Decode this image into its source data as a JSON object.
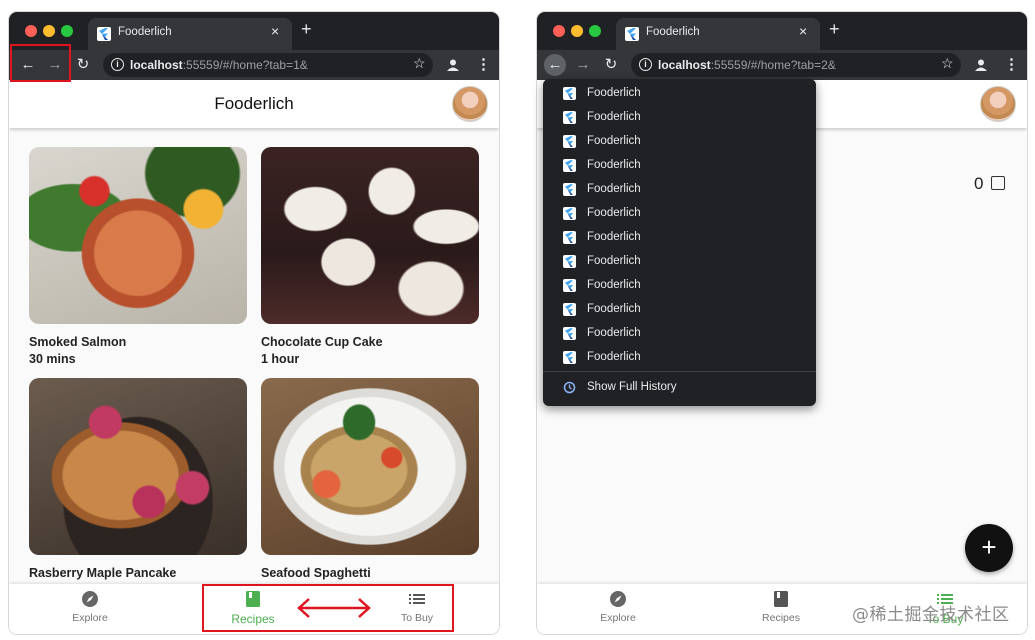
{
  "left_window": {
    "tab_title": "Fooderlich",
    "url_host": "localhost",
    "url_rest": ":55559/#/home?tab=1&",
    "app_title": "Fooderlich",
    "recipes": [
      {
        "title": "Smoked Salmon",
        "subtitle": "30 mins"
      },
      {
        "title": "Chocolate Cup Cake",
        "subtitle": "1 hour"
      },
      {
        "title": "Rasberry Maple Pancake",
        "subtitle": ""
      },
      {
        "title": "Seafood Spaghetti",
        "subtitle": ""
      }
    ],
    "bottom_nav": [
      {
        "label": "Explore",
        "icon": "compass-icon"
      },
      {
        "label": "Recipes",
        "icon": "book-icon",
        "active": true
      },
      {
        "label": "To Buy",
        "icon": "list-icon"
      }
    ]
  },
  "right_window": {
    "tab_title": "Fooderlich",
    "url_host": "localhost",
    "url_rest": ":55559/#/home?tab=2&",
    "app_title_fragment": "h",
    "counter": "0",
    "history": {
      "items": [
        "Fooderlich",
        "Fooderlich",
        "Fooderlich",
        "Fooderlich",
        "Fooderlich",
        "Fooderlich",
        "Fooderlich",
        "Fooderlich",
        "Fooderlich",
        "Fooderlich",
        "Fooderlich",
        "Fooderlich"
      ],
      "show_full": "Show Full History"
    },
    "bottom_nav": [
      {
        "label": "Explore",
        "icon": "compass-icon"
      },
      {
        "label": "Recipes",
        "icon": "book-icon"
      },
      {
        "label": "To Buy",
        "icon": "list-icon",
        "active": true
      }
    ]
  },
  "watermark": "@稀土掘金技术社区",
  "colors": {
    "accent": "#4caf50",
    "annotation": "#e0141e",
    "chrome_dark": "#202124",
    "chrome_toolbar": "#35363a"
  }
}
